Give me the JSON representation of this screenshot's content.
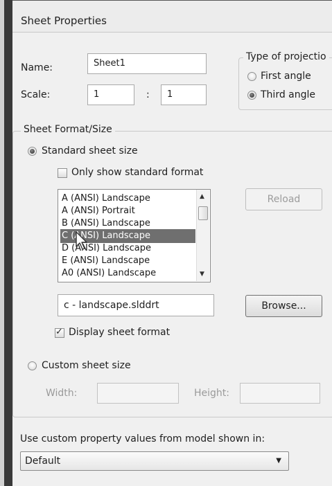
{
  "dialog": {
    "title": "Sheet Properties"
  },
  "name_field": {
    "label": "Name:",
    "value": "Sheet1"
  },
  "scale": {
    "label": "Scale:",
    "left": "1",
    "separator": ":",
    "right": "1"
  },
  "projection": {
    "group_label": "Type of projectio",
    "options": [
      {
        "label": "First angle",
        "selected": false
      },
      {
        "label": "Third angle",
        "selected": true
      }
    ]
  },
  "sheet_format": {
    "group_label": "Sheet Format/Size",
    "standard_option": {
      "label": "Standard sheet size",
      "selected": true
    },
    "only_standard_checkbox": {
      "label": "Only show standard format",
      "checked": false
    },
    "sheet_list": {
      "items": [
        "A (ANSI) Landscape",
        "A (ANSI) Portrait",
        "B (ANSI) Landscape",
        "C (ANSI) Landscape",
        "D (ANSI) Landscape",
        "E (ANSI) Landscape",
        "A0 (ANSI) Landscape"
      ],
      "selected": "C (ANSI) Landscape"
    },
    "reload_button": "Reload",
    "format_file": "c - landscape.slddrt",
    "browse_button": "Browse...",
    "display_format_checkbox": {
      "label": "Display sheet format",
      "checked": true
    },
    "custom_option": {
      "label": "Custom sheet size",
      "selected": false
    },
    "width": {
      "label": "Width:",
      "value": ""
    },
    "height": {
      "label": "Height:",
      "value": ""
    }
  },
  "model_property": {
    "label": "Use custom property values from model shown in:",
    "selected": "Default"
  }
}
